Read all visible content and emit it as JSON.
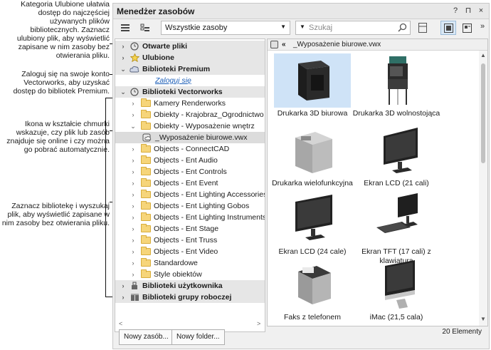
{
  "callouts": [
    "Kategoria Ulubione ułatwia dostęp do najczęściej używanych plików bibliotecznych. Zaznacz ulubiony plik, aby wyświetlić zapisane w nim zasoby bez otwierania pliku.",
    "Zaloguj się na swoje konto Vectorworks, aby uzyskać dostęp do bibliotek Premium.",
    "Ikona w kształcie chmurki wskazuje, czy plik lub zasób znajduje się online i czy można go pobrać automatycznie.",
    "Zaznacz bibliotekę i wyszukaj plik, aby wyświetlić zapisane w nim zasoby bez otwierania pliku."
  ],
  "panel": {
    "title": "Menedżer zasobów",
    "controls": [
      "?",
      "⊓",
      "×"
    ]
  },
  "toolbar": {
    "filter_value": "Wszystkie zasoby",
    "search_placeholder": "Szukaj"
  },
  "tree": [
    {
      "label": "Otwarte pliki",
      "type": "cat",
      "icon": "clock-icon",
      "expanded": false
    },
    {
      "label": "Ulubione",
      "type": "cat",
      "icon": "star-icon",
      "expanded": false
    },
    {
      "label": "Biblioteki Premium",
      "type": "cat",
      "icon": "cloud-icon",
      "expanded": true
    },
    {
      "label": "Zaloguj się",
      "type": "link"
    },
    {
      "label": "Biblioteki Vectorworks",
      "type": "cat",
      "icon": "clock-icon",
      "expanded": true
    },
    {
      "label": "Kamery Renderworks",
      "type": "folder",
      "indent": 1,
      "expanded": false
    },
    {
      "label": "Obiekty - Krajobraz_Ogrodnictwo",
      "type": "folder",
      "indent": 1,
      "expanded": false
    },
    {
      "label": "Obiekty - Wyposażenie wnętrz",
      "type": "folder",
      "indent": 1,
      "expanded": true
    },
    {
      "label": "_Wyposażenie biurowe.vwx",
      "type": "file",
      "indent": 2,
      "selected": true
    },
    {
      "label": "Objects - ConnectCAD",
      "type": "folder",
      "indent": 1
    },
    {
      "label": "Objects - Ent Audio",
      "type": "folder",
      "indent": 1
    },
    {
      "label": "Objects - Ent Controls",
      "type": "folder",
      "indent": 1
    },
    {
      "label": "Objects - Ent Event",
      "type": "folder",
      "indent": 1
    },
    {
      "label": "Objects - Ent Lighting Accessories",
      "type": "folder",
      "indent": 1
    },
    {
      "label": "Objects - Ent Lighting Gobos",
      "type": "folder",
      "indent": 1
    },
    {
      "label": "Objects - Ent Lighting Instruments",
      "type": "folder",
      "indent": 1
    },
    {
      "label": "Objects - Ent Stage",
      "type": "folder",
      "indent": 1
    },
    {
      "label": "Objects - Ent Truss",
      "type": "folder",
      "indent": 1
    },
    {
      "label": "Objects - Ent Video",
      "type": "folder",
      "indent": 1
    },
    {
      "label": "Standardowe",
      "type": "folder",
      "indent": 1
    },
    {
      "label": "Style obiektów",
      "type": "folder",
      "indent": 1
    },
    {
      "label": "Biblioteki użytkownika",
      "type": "cat",
      "icon": "user-lib-icon",
      "expanded": false
    },
    {
      "label": "Biblioteki grupy roboczej",
      "type": "cat",
      "icon": "workgroup-icon",
      "expanded": false
    }
  ],
  "path": {
    "back": "«",
    "file": "_Wyposażenie biurowe.vwx"
  },
  "resources": [
    {
      "name": "Drukarka 3D biurowa",
      "icon": "3d-printer-icon",
      "selected": true
    },
    {
      "name": "Drukarka 3D wolnostojąca",
      "icon": "standing-3d-printer-icon"
    },
    {
      "name": "Drukarka wielofunkcyjna",
      "icon": "mfp-printer-icon"
    },
    {
      "name": "Ekran LCD (21 cali)",
      "icon": "lcd-monitor-icon"
    },
    {
      "name": "Ekran LCD (24 cale)",
      "icon": "lcd-monitor-icon"
    },
    {
      "name": "Ekran TFT (17 cali) z klawiaturą",
      "icon": "tft-keyboard-icon"
    },
    {
      "name": "Faks z telefonem",
      "icon": "fax-icon"
    },
    {
      "name": "iMac (21,5 cala)",
      "icon": "imac-icon"
    }
  ],
  "status": {
    "count": "20 Elementy"
  },
  "buttons": {
    "new_resource": "Nowy zasób...",
    "new_folder": "Nowy folder..."
  },
  "colors": {
    "selection": "#cfe3f7",
    "link": "#1d5fb8",
    "folder": "#f6d57a"
  }
}
